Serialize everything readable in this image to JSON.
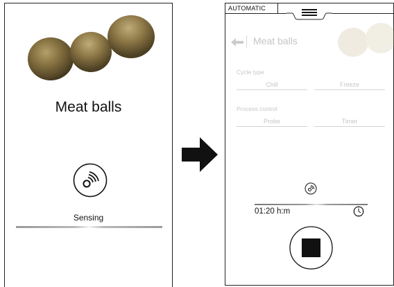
{
  "left_screen": {
    "title": "Meat balls",
    "status_label": "Sensing"
  },
  "right_screen": {
    "mode_tab": "AUTOMATIC",
    "title": "Meat balls",
    "cycle_type_label": "Cycle type",
    "cycle_options": [
      "Chill",
      "Freeze"
    ],
    "process_control_label": "Process control",
    "process_options": [
      "Probe",
      "Timer"
    ],
    "time_display": "01:20 h:m"
  },
  "icons": {
    "menu": "hamburger-icon",
    "back": "back-arrow-icon",
    "sensing": "sensing-icon",
    "progress": "progress-icon",
    "clock": "clock-icon",
    "stop": "stop-icon",
    "flow": "right-arrow-icon"
  }
}
